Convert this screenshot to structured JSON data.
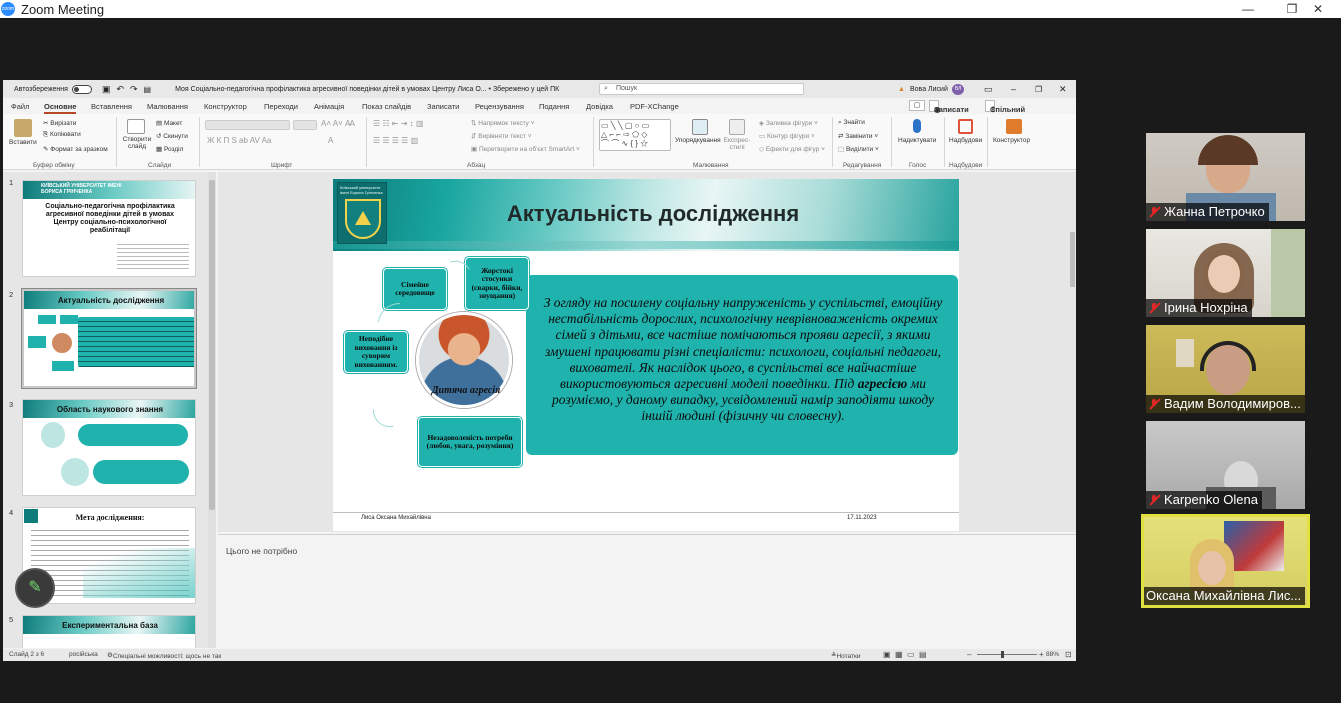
{
  "zoom": {
    "title": "Zoom Meeting",
    "logo_text": "zoom",
    "controls": [
      "—",
      "❐",
      "✕"
    ]
  },
  "ppt": {
    "autosave_label": "Автозбереження",
    "doc_title": "Моя Соціально-педагогічна профілактика агресивної поведінки дітей в умовах Центру Лиса О... • Збережено у цей ПК",
    "search_placeholder": "Пошук",
    "user_name": "Вова Лисий",
    "user_initials": "ВЛ",
    "menu": [
      "Файл",
      "Основне",
      "Вставлення",
      "Малювання",
      "Конструктор",
      "Переходи",
      "Анімація",
      "Показ слайдів",
      "Записати",
      "Рецензування",
      "Подання",
      "Довідка",
      "PDF-XChange"
    ],
    "record_button": "Записати",
    "share_button": "Спільний доступ",
    "ribbon": {
      "paste": "Вставити",
      "cut": "Вирізати",
      "copy": "Копіювати",
      "format_painter": "Формат за зразком",
      "clipboard_group": "Буфер обміну",
      "new_slide": "Створити слайд",
      "layout": "Макет",
      "reset": "Скинути",
      "section": "Розділ",
      "slides_group": "Слайди",
      "font_group": "Шрифт",
      "text_direction": "Напрямок тексту",
      "align_text": "Вирівняти текст",
      "smartart": "Перетворити на об'єкт SmartArt",
      "paragraph_group": "Абзац",
      "arrange": "Упорядкування",
      "quick_styles": "Експрес-стилі",
      "shape_fill": "Заливка фігури",
      "shape_outline": "Контур фігури",
      "shape_effects": "Ефекти для фігур",
      "drawing_group": "Малювання",
      "find": "Знайти",
      "replace": "Замінити",
      "select": "Виділити",
      "editing_group": "Редагування",
      "dictate": "Надиктувати",
      "voice_group": "Голос",
      "designer": "Надбудови",
      "addins_group": "Надбудови",
      "constructor": "Конструктор"
    },
    "thumbs": [
      {
        "num": "1",
        "title": "Соціально-педагогічна профілактика агресивної поведінки дітей в умовах Центру соціально-психологічної реабілітації",
        "uni": "КИЇВСЬКИЙ УНІВЕРСИТЕТ ІМЕНІ БОРИСА ГРІНЧЕНКА"
      },
      {
        "num": "2",
        "title": "Актуальність дослідження"
      },
      {
        "num": "3",
        "title": "Область наукового знання"
      },
      {
        "num": "4",
        "title": "Мета дослідження:"
      },
      {
        "num": "5",
        "title": "Експериментальна база"
      }
    ],
    "slide": {
      "logo_text": "Київський університет імені Бориса Грінченка",
      "title": "Актуальність дослідження",
      "body_part1": "З огляду на  посилену соціальну напруженість у суспільстві, емоційну нестабільність дорослих, психологічну неврівноваженість окремих сімей з дітьми, все частіше помічаються прояви агресії, з якими змушені працювати різні спеціалісти: психологи, соціальні педагоги, вихователі. Як наслідок цього, в суспільстві все найчастіше використовуються агресивні моделі поведінки. Під ",
      "body_bold": "агресією",
      "body_part2": " ми розуміємо, у даному випадку, усвідомлений намір заподіяти шкоду іншій людині (фізичну чи словесну).",
      "node_env": "Сімейне середовище",
      "node_cruel": "Жорстокі стосунки (сварки, бійки, знущання)",
      "node_improper": "Неподібне виховання із суворим вихованням.",
      "node_needs": "Незадоволеність потреби (любов, увага, розуміння)",
      "photo_caption": "Дитяча агресія",
      "footer_name": "Лиса Оксана Михайлівна",
      "footer_date": "17.11.2023"
    },
    "notes_placeholder": "Цього не потрібно",
    "status": {
      "slide_of": "Слайд 2 з 6",
      "language": "російська",
      "accessibility": "Спеціальні можливості: щось не так",
      "notes": "Нотатки",
      "zoom": "88%"
    }
  },
  "participants": [
    {
      "name": "Жанна Петрочко",
      "muted": true
    },
    {
      "name": "Ірина Нохріна",
      "muted": true
    },
    {
      "name": "Вадим Володимиров...",
      "muted": true
    },
    {
      "name": "Karpenko Olena",
      "muted": true
    },
    {
      "name": "Оксана Михайлівна Лис...",
      "muted": false,
      "active": true
    }
  ],
  "colors": {
    "teal": "#20b3ad",
    "ppt_accent": "#b7472a",
    "active_speaker": "#e0e040"
  }
}
